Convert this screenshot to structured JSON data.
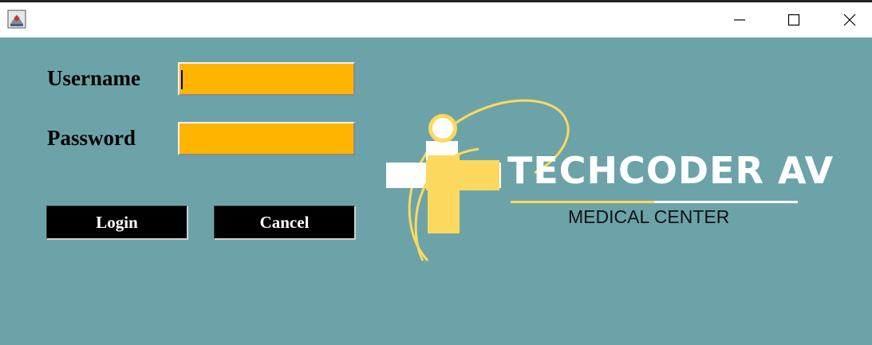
{
  "window": {
    "icon": "java-app-icon",
    "controls": [
      "minimize-icon",
      "maximize-icon",
      "close-icon"
    ]
  },
  "form": {
    "username_label": "Username",
    "password_label": "Password",
    "username_value": "",
    "password_value": "",
    "login_label": "Login",
    "cancel_label": "Cancel"
  },
  "logo": {
    "brand": "TECHCODER AV",
    "subtitle": "MEDICAL CENTER"
  },
  "colors": {
    "background": "#6ca3a9",
    "field": "#ffb400",
    "logo_accent": "#fcd95e",
    "button": "#000000"
  }
}
